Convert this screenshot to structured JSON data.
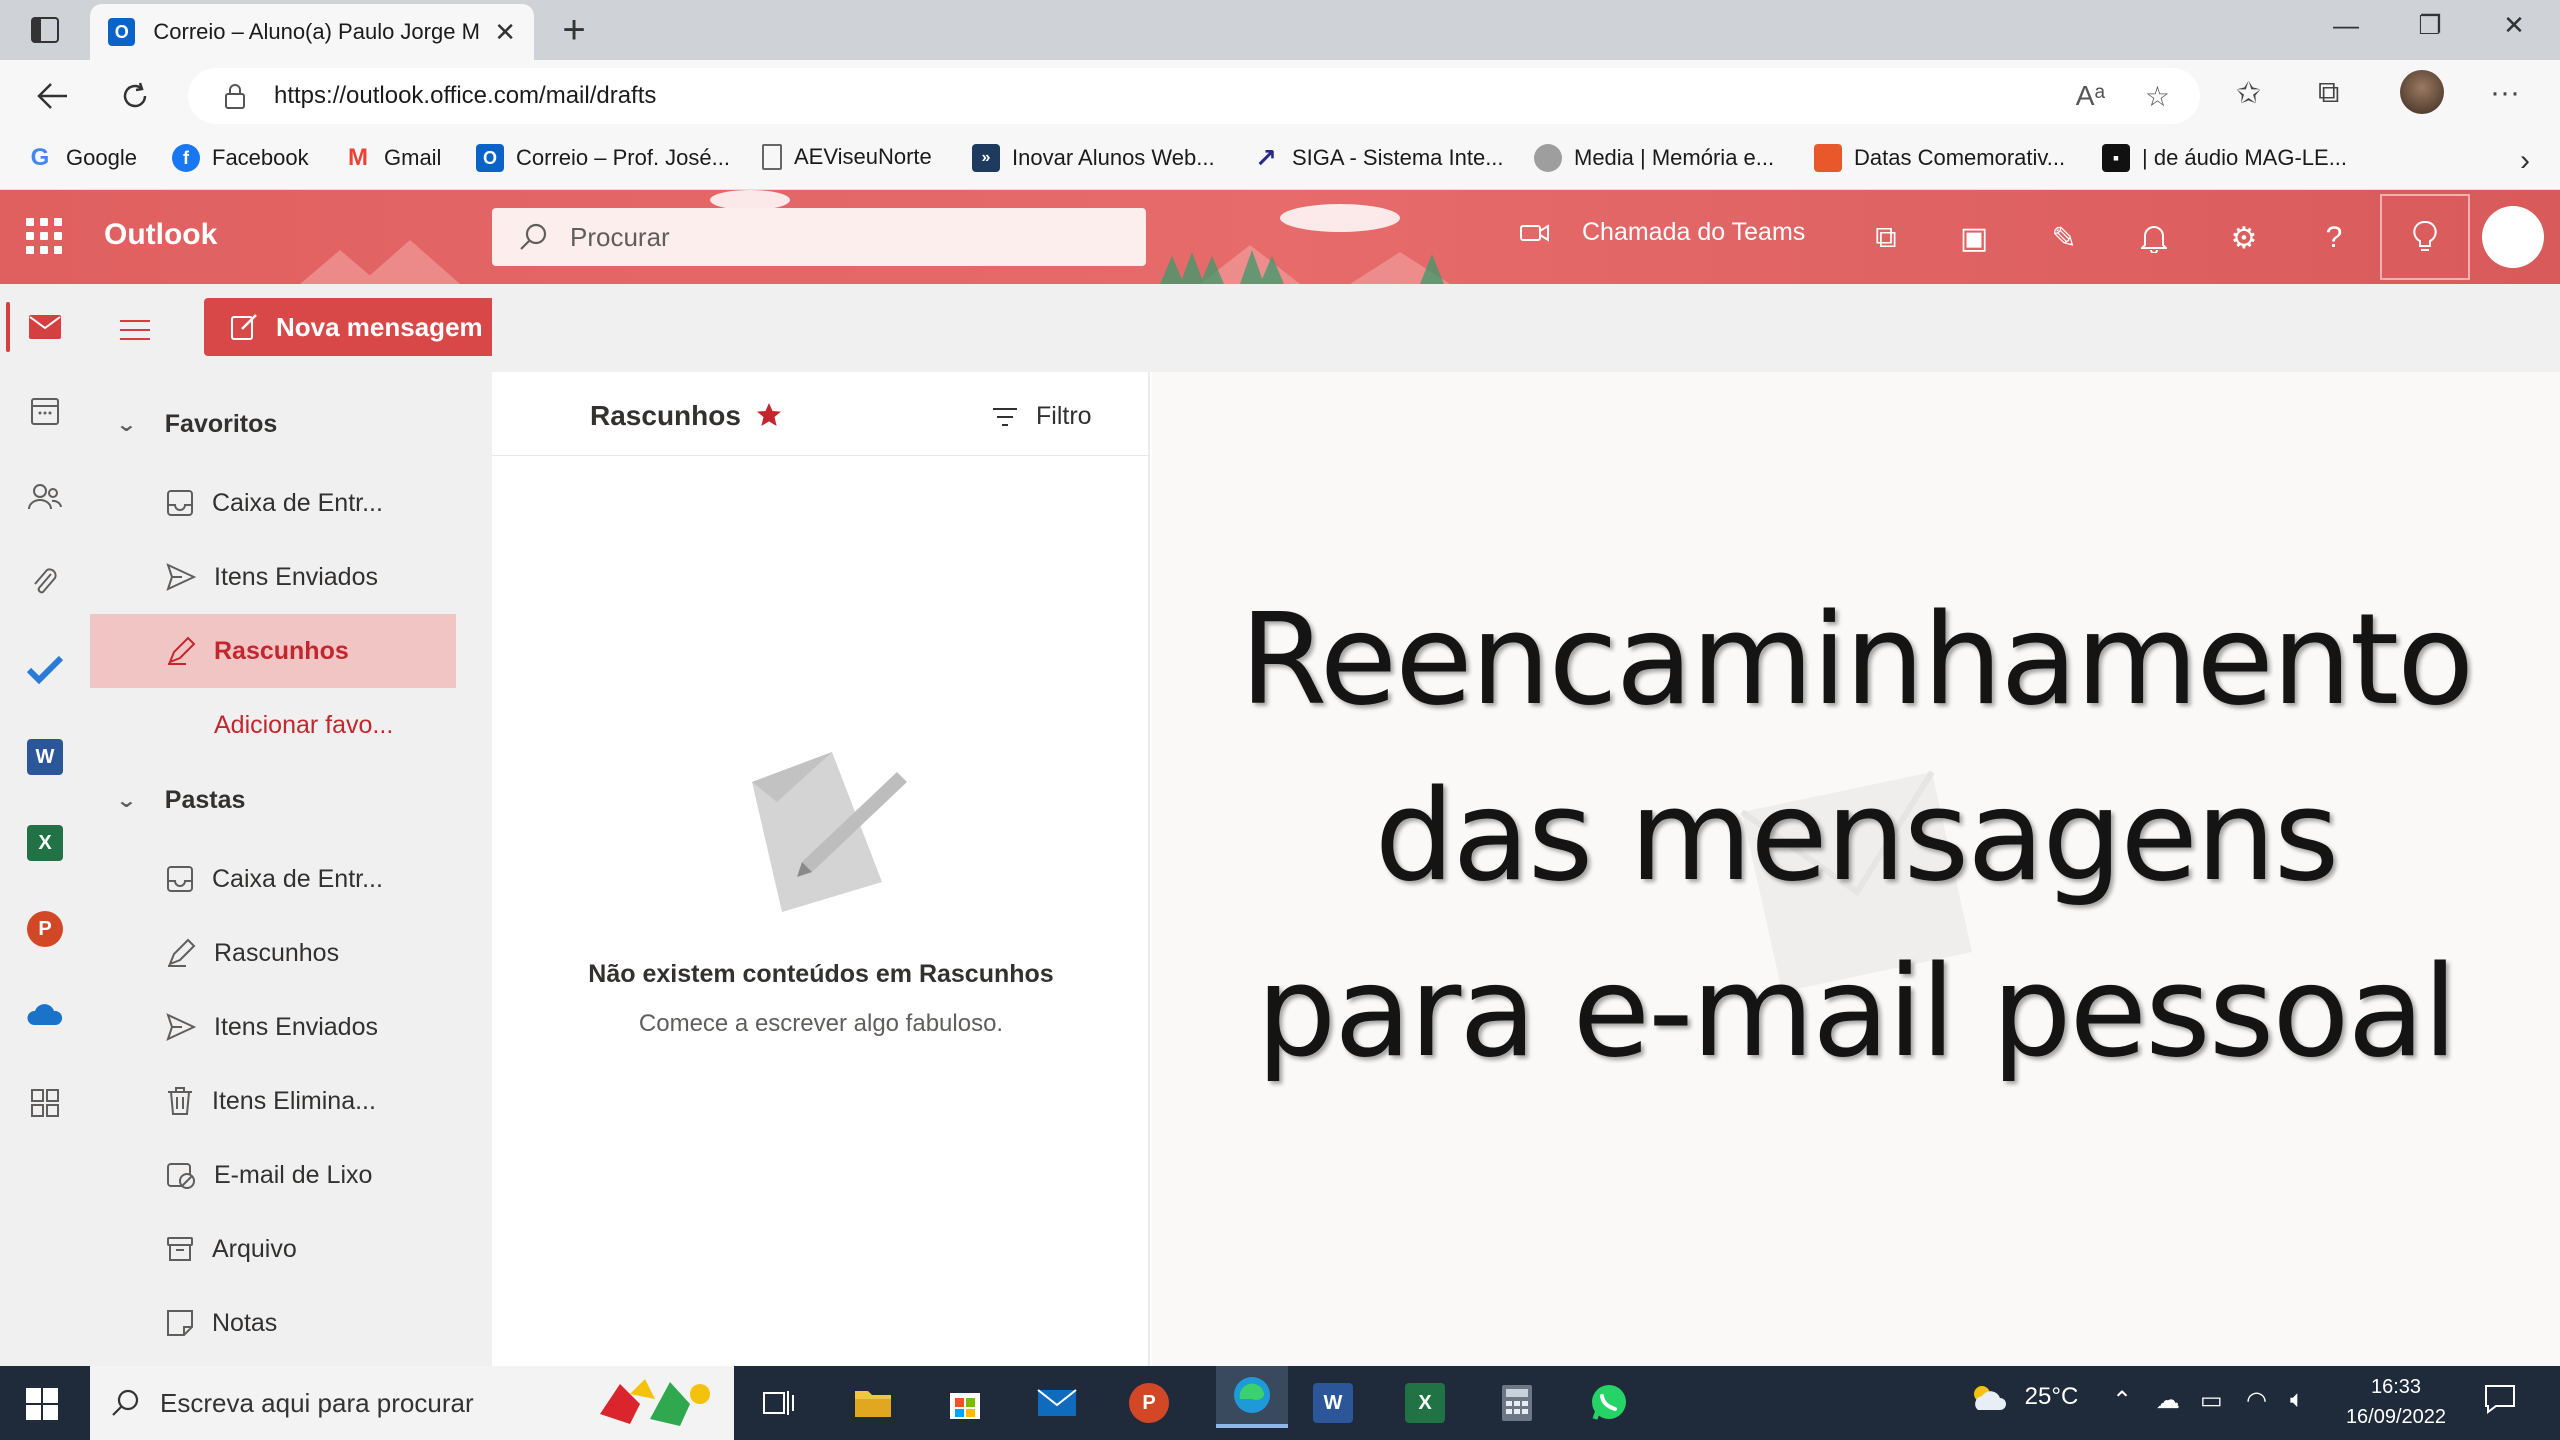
{
  "browser": {
    "tab_title": "Correio – Aluno(a) Paulo Jorge M",
    "url": "https://outlook.office.com/mail/drafts",
    "bookmarks": [
      {
        "label": "Google",
        "icon": "google-icon",
        "color": "#4285f4"
      },
      {
        "label": "Facebook",
        "icon": "facebook-icon",
        "color": "#1877f2"
      },
      {
        "label": "Gmail",
        "icon": "gmail-icon",
        "color": "#ea4335"
      },
      {
        "label": "Correio – Prof. José...",
        "icon": "outlook-icon",
        "color": "#0a64c8"
      },
      {
        "label": "AEViseuNorte",
        "icon": "page-icon",
        "color": "#888888"
      },
      {
        "label": "Inovar Alunos Web...",
        "icon": "inovar-icon",
        "color": "#1e3a5f"
      },
      {
        "label": "SIGA - Sistema Inte...",
        "icon": "siga-icon",
        "color": "#2a2a8a"
      },
      {
        "label": "Media | Memória e...",
        "icon": "media-icon",
        "color": "#9e9e9e"
      },
      {
        "label": "Datas Comemorativ...",
        "icon": "calendar-icon",
        "color": "#e8582a"
      },
      {
        "label": "| de áudio MAG-LE...",
        "icon": "audio-icon",
        "color": "#111111"
      }
    ]
  },
  "outlook": {
    "brand": "Outlook",
    "search_placeholder": "Procurar",
    "teams_call": "Chamada do Teams",
    "accent": "#d94848",
    "new_message": "Nova mensagem",
    "favorites_label": "Favoritos",
    "favorites": [
      {
        "label": "Caixa de Entr...",
        "icon": "inbox-icon"
      },
      {
        "label": "Itens Enviados",
        "icon": "send-icon"
      },
      {
        "label": "Rascunhos",
        "icon": "draft-icon",
        "selected": true
      }
    ],
    "add_favorite": "Adicionar favo...",
    "folders_label": "Pastas",
    "folders": [
      {
        "label": "Caixa de Entr...",
        "icon": "inbox-icon"
      },
      {
        "label": "Rascunhos",
        "icon": "draft-icon"
      },
      {
        "label": "Itens Enviados",
        "icon": "send-icon"
      },
      {
        "label": "Itens Elimina...",
        "icon": "trash-icon"
      },
      {
        "label": "E-mail de Lixo",
        "icon": "junk-icon"
      },
      {
        "label": "Arquivo",
        "icon": "archive-icon"
      },
      {
        "label": "Notas",
        "icon": "notes-icon"
      }
    ],
    "list_title": "Rascunhos",
    "filter_label": "Filtro",
    "empty_title": "Não existem conteúdos em Rascunhos",
    "empty_subtitle": "Comece a escrever algo fabuloso."
  },
  "overlay": {
    "line1": "Reencaminhamento",
    "line2": "das mensagens",
    "line3": "para e-mail pessoal"
  },
  "taskbar": {
    "search_placeholder": "Escreva aqui para procurar",
    "weather": "25°C",
    "time": "16:33",
    "date": "16/09/2022"
  }
}
